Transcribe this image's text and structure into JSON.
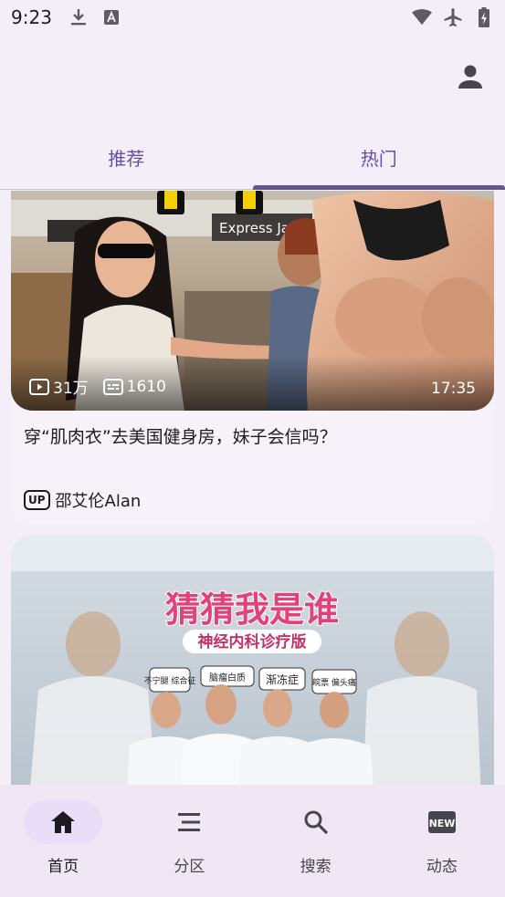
{
  "status_bar": {
    "time": "9:23",
    "left_icons": [
      "download-icon",
      "text-a-icon"
    ],
    "right_icons": [
      "wifi-icon",
      "airplane-icon",
      "battery-charging-icon"
    ]
  },
  "app_bar": {
    "account_icon": "account-icon"
  },
  "tabs": [
    {
      "label": "推荐",
      "active": false
    },
    {
      "label": "热门",
      "active": true
    }
  ],
  "feed": {
    "items": [
      {
        "views": "31万",
        "danmaku": "1610",
        "duration": "17:35",
        "title": "穿“肌肉衣”去美国健身房，妹子会信吗？",
        "author_badge": "UP",
        "author": "邵艾伦Alan",
        "thumbnail_overlay_text": "Express Japan"
      },
      {
        "thumbnail_title": "猜猜我是谁",
        "thumbnail_subtitle": "神经内科诊疗版",
        "thumbnail_tags": [
          "不宁腿 综合征",
          "脑瘤白质",
          "渐冻症",
          "皖票 偏头痛"
        ]
      }
    ]
  },
  "bottom_nav": [
    {
      "label": "首页",
      "icon": "home-icon",
      "active": true
    },
    {
      "label": "分区",
      "icon": "list-icon",
      "active": false
    },
    {
      "label": "搜索",
      "icon": "search-icon",
      "active": false
    },
    {
      "label": "动态",
      "icon": "new-badge-icon",
      "active": false
    }
  ],
  "colors": {
    "background": "#f3eef8",
    "accent": "#65558f",
    "tab_text": "#6750a4",
    "nav_active_pill": "#e8def8"
  }
}
